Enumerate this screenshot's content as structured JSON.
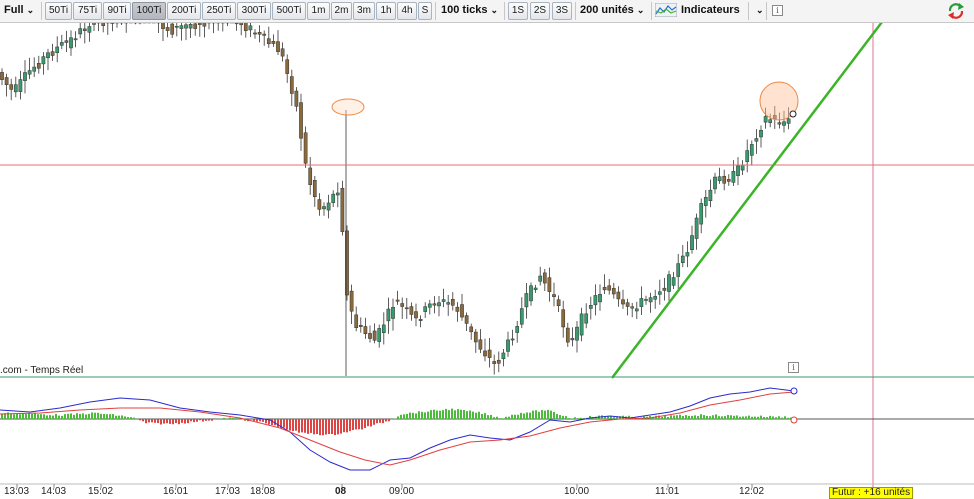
{
  "toolbar": {
    "mode_label": "Full",
    "tick_buttons": [
      "50Ti",
      "75Ti",
      "90Ti",
      "100Ti",
      "200Ti",
      "250Ti",
      "300Ti",
      "500Ti",
      "1m",
      "2m",
      "3m",
      "1h",
      "4h",
      "S"
    ],
    "active_button": "100Ti",
    "ticks_dropdown": "100 ticks",
    "second_buttons": [
      "1S",
      "2S",
      "3S"
    ],
    "units_dropdown": "200 unités",
    "indicators_label": "Indicateurs",
    "info_symbol": "i"
  },
  "chart": {
    "source_label": ".com - Temps Réel",
    "info_symbol": "i",
    "time_labels": [
      "13:03",
      "14:03",
      "15:02",
      "16:01",
      "17:03",
      "18:08",
      "08",
      "09:00",
      "10:00",
      "11:01",
      "12:02"
    ],
    "bold_time_label": "08",
    "futur_label": "Futur : +16 unités"
  },
  "colors": {
    "up_candle": "#3a9a6e",
    "down_candle": "#8a6a3c",
    "trendline": "#3cb428",
    "horizontal_line": "#e07070",
    "crosshair": "#e07090",
    "macd_line": "#2a2acc",
    "signal_line": "#e04040",
    "hist_up": "#4cbb3c",
    "hist_down": "#dd4444",
    "highlight_ellipse": "#ee8844"
  },
  "icons": {
    "menu_chevron": "chevron-down-icon",
    "indicators": "indicator-wave-icon",
    "refresh": "refresh-arrows-icon",
    "info": "info-icon"
  }
}
